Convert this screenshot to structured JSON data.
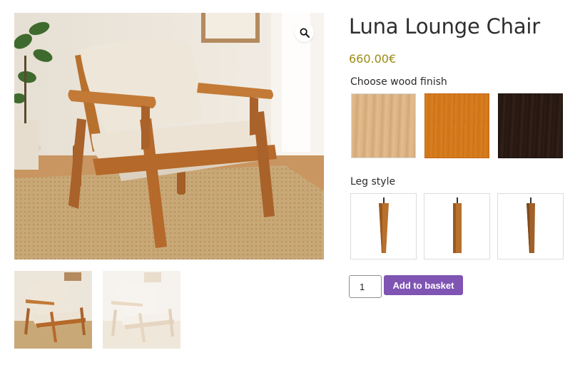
{
  "product": {
    "title": "Luna Lounge Chair",
    "price": "660.00€"
  },
  "gallery": {
    "main_image": "luna-chair-in-living-room",
    "zoom_icon": "magnifier-icon",
    "thumbnails": [
      "luna-chair-oak-thumb",
      "luna-chair-light-thumb"
    ]
  },
  "wood_finish": {
    "label": "Choose wood finish",
    "options": [
      {
        "name": "light-oak",
        "color": "#dcb487"
      },
      {
        "name": "cherry",
        "color": "#d27a1f"
      },
      {
        "name": "espresso",
        "color": "#2a1a13"
      }
    ]
  },
  "leg_style": {
    "label": "Leg style",
    "options": [
      "tapered-leg",
      "straight-leg",
      "angled-leg"
    ]
  },
  "purchase": {
    "quantity": "1",
    "add_label": "Add to basket"
  },
  "colors": {
    "accent": "#7f54b3",
    "price": "#9c8a14",
    "wood": "#b8702d"
  }
}
